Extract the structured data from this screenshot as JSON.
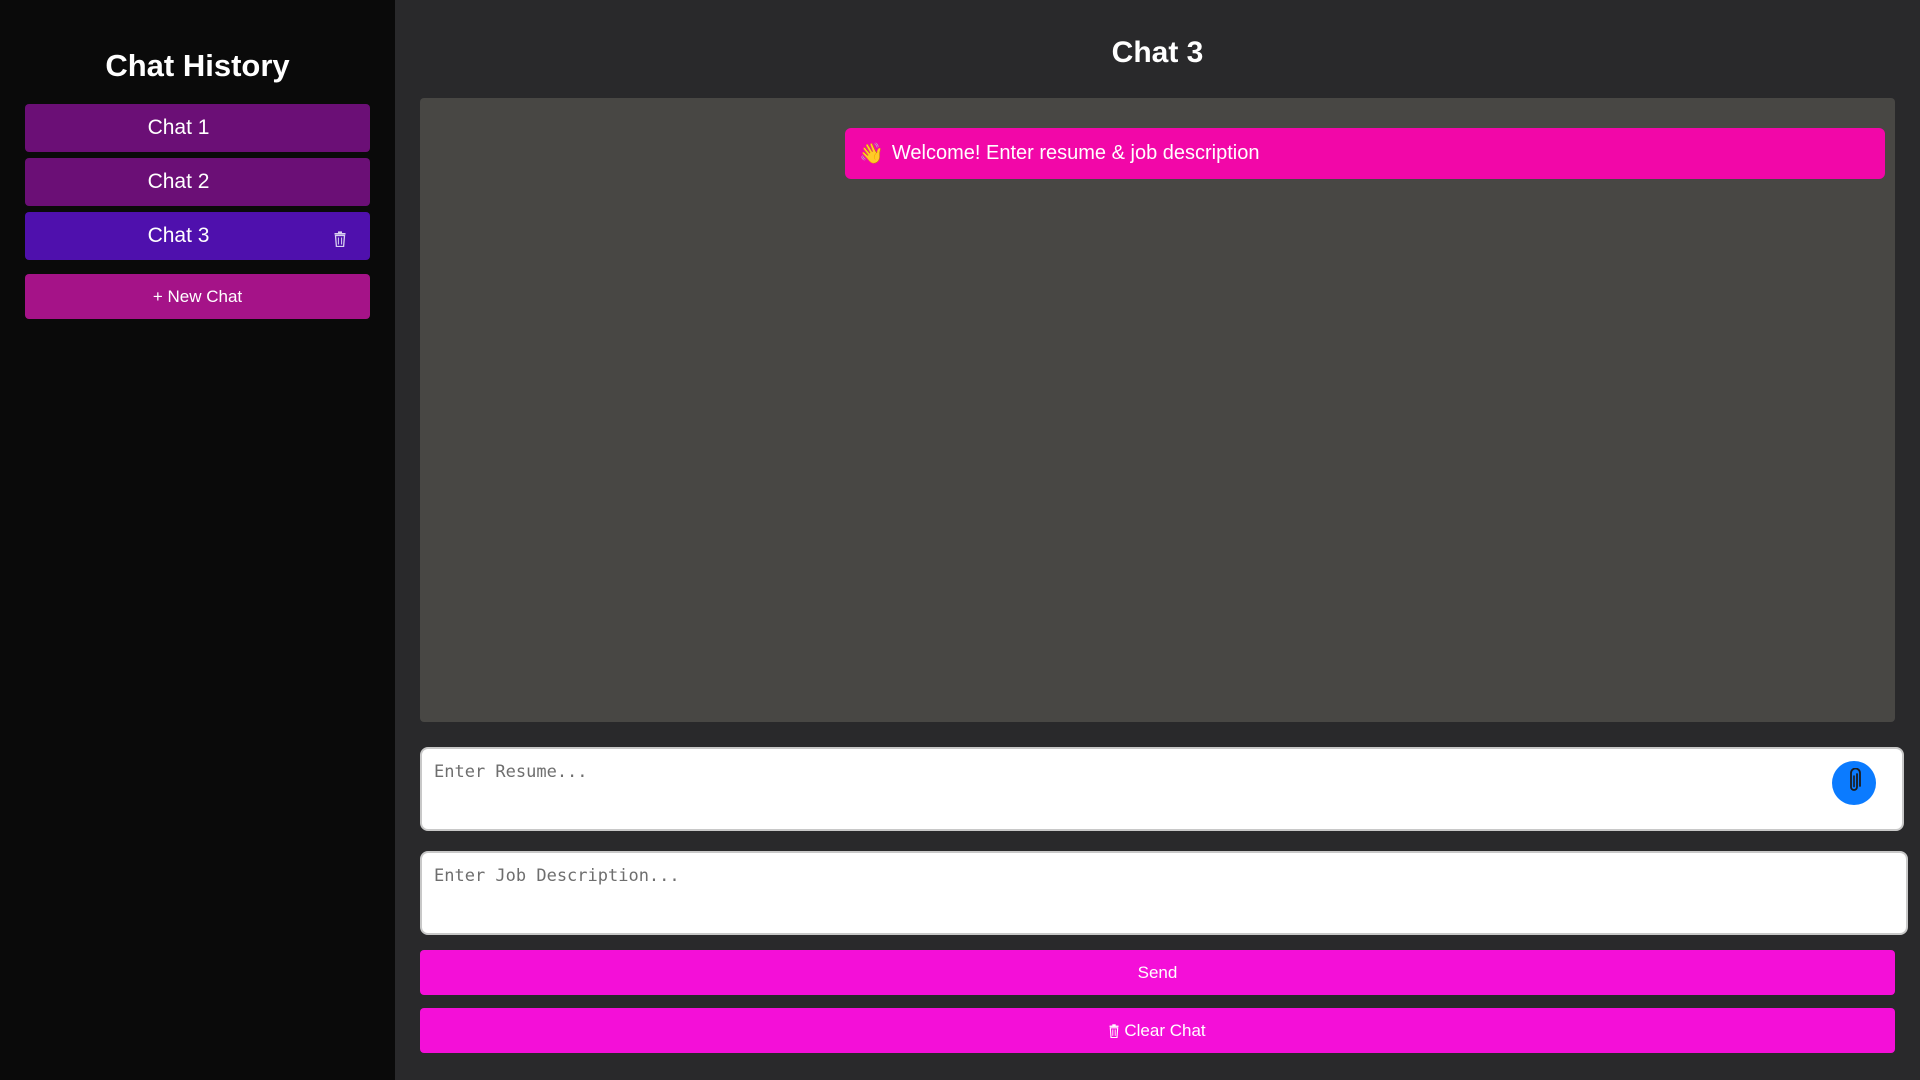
{
  "sidebar": {
    "title": "Chat History",
    "items": [
      {
        "label": "Chat 1",
        "active": false
      },
      {
        "label": "Chat 2",
        "active": false
      },
      {
        "label": "Chat 3",
        "active": true
      }
    ],
    "new_chat_label": "+ New Chat"
  },
  "main": {
    "title": "Chat 3",
    "messages": [
      {
        "emoji": "👋",
        "text": "Welcome! Enter resume & job description"
      }
    ],
    "resume_placeholder": "Enter Resume...",
    "job_placeholder": "Enter Job Description...",
    "send_label": "Send",
    "clear_label": "Clear Chat"
  },
  "colors": {
    "sidebar_bg": "#0a0a0a",
    "main_bg": "#29292b",
    "chat_item": "#6b0f76",
    "chat_item_active": "#4f10ad",
    "new_chat": "#a51388",
    "bubble": "#f207a8",
    "action_button": "#f40fd8",
    "attach_button": "#0b7bff"
  },
  "icons": {
    "delete": "trash-icon",
    "attach": "paperclip-icon",
    "clear": "trash-icon",
    "wave": "waving-hand-icon"
  }
}
